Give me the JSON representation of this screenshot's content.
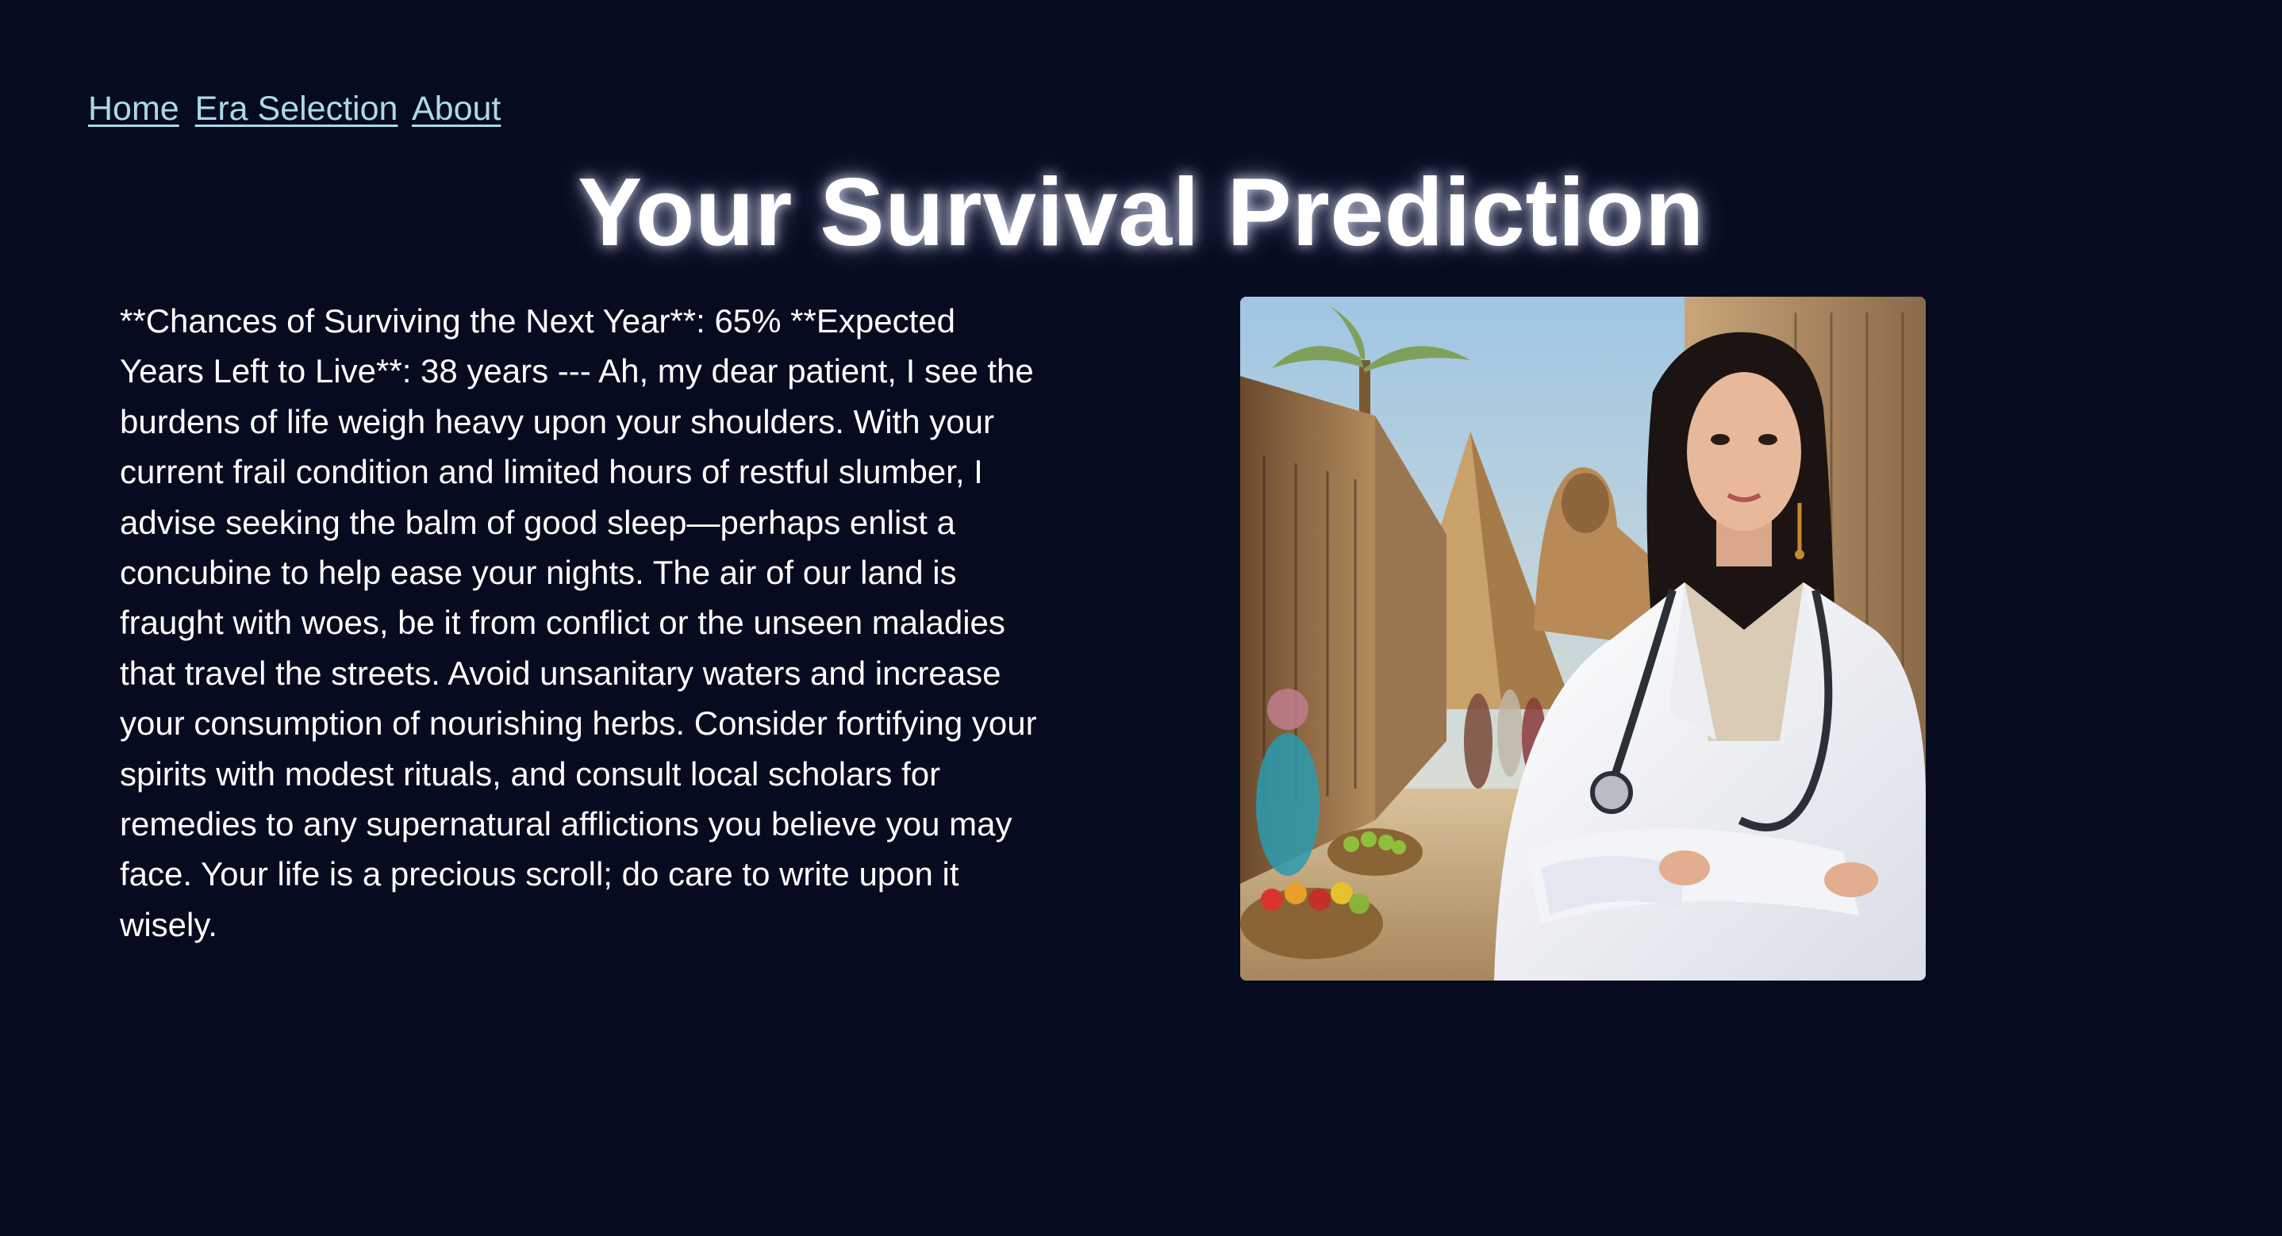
{
  "nav": {
    "links": [
      {
        "label": "Home"
      },
      {
        "label": "Era Selection"
      },
      {
        "label": "About"
      }
    ]
  },
  "page_title": "Your Survival Prediction",
  "prediction": {
    "text": "**Chances of Surviving the Next Year**: 65% **Expected Years Left to Live**: 38 years --- Ah, my dear patient, I see the burdens of life weigh heavy upon your shoulders. With your current frail condition and limited hours of restful slumber, I advise seeking the balm of good sleep—perhaps enlist a concubine to help ease your nights. The air of our land is fraught with woes, be it from conflict or the unseen maladies that travel the streets. Avoid unsanitary waters and increase your consumption of nourishing herbs. Consider fortifying your spirits with modest rituals, and consult local scholars for remedies to any supernatural afflictions you believe you may face. Your life is a precious scroll; do care to write upon it wisely."
  },
  "colors": {
    "background": "#070b1f",
    "link": "#a9dbe6",
    "text": "#ffffff"
  }
}
